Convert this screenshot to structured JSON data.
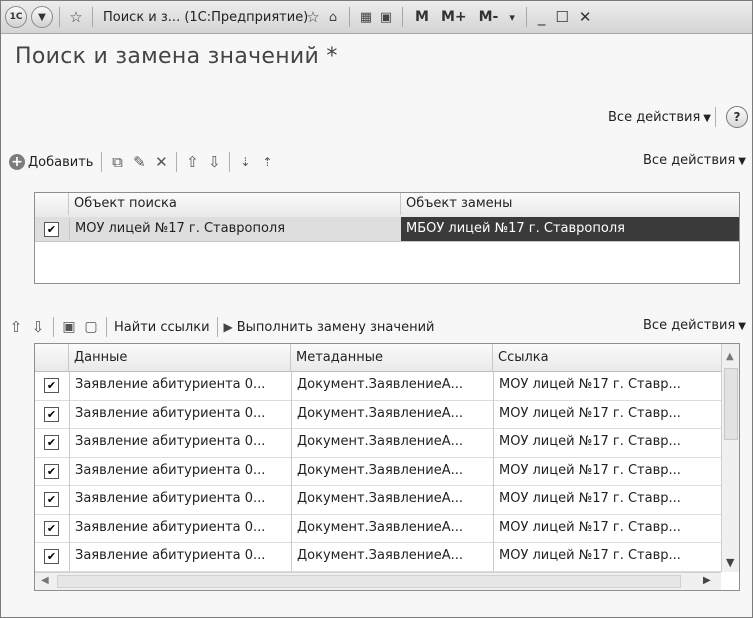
{
  "window": {
    "title": "Поиск и з...  (1С:Предприятие)",
    "logo": "1C",
    "title_bar_icons": [
      "star-icon",
      "star-add-icon",
      "bookmark-icon",
      "calculator-icon",
      "calendar-icon"
    ],
    "memory_buttons": [
      "M",
      "M+",
      "M-"
    ]
  },
  "form": {
    "title": "Поиск и замена значений *",
    "all_actions_label": "Все действия",
    "help_label": "?"
  },
  "toolbar1": {
    "add_label": "Добавить",
    "all_actions_label": "Все действия"
  },
  "grid1": {
    "columns": [
      "Объект поиска",
      "Объект замены"
    ],
    "rows": [
      {
        "checked": true,
        "search": "МОУ лицей №17 г. Ставрополя",
        "replace": "МБОУ лицей №17 г. Ставрополя"
      }
    ]
  },
  "toolbar2": {
    "find_links_label": "Найти ссылки",
    "replace_label": "Выполнить замену значений",
    "all_actions_label": "Все действия"
  },
  "grid2": {
    "columns": [
      "Данные",
      "Метаданные",
      "Ссылка"
    ],
    "rows": [
      {
        "checked": true,
        "data": "Заявление абитуриента 0...",
        "meta": "Документ.ЗаявлениеА...",
        "link": "МОУ лицей №17 г. Ставр..."
      },
      {
        "checked": true,
        "data": "Заявление абитуриента 0...",
        "meta": "Документ.ЗаявлениеА...",
        "link": "МОУ лицей №17 г. Ставр..."
      },
      {
        "checked": true,
        "data": "Заявление абитуриента 0...",
        "meta": "Документ.ЗаявлениеА...",
        "link": "МОУ лицей №17 г. Ставр..."
      },
      {
        "checked": true,
        "data": "Заявление абитуриента 0...",
        "meta": "Документ.ЗаявлениеА...",
        "link": "МОУ лицей №17 г. Ставр..."
      },
      {
        "checked": true,
        "data": "Заявление абитуриента 0...",
        "meta": "Документ.ЗаявлениеА...",
        "link": "МОУ лицей №17 г. Ставр..."
      },
      {
        "checked": true,
        "data": "Заявление абитуриента 0...",
        "meta": "Документ.ЗаявлениеА...",
        "link": "МОУ лицей №17 г. Ставр..."
      },
      {
        "checked": true,
        "data": "Заявление абитуриента 0...",
        "meta": "Документ.ЗаявлениеА...",
        "link": "МОУ лицей №17 г. Ставр..."
      }
    ]
  },
  "colors": {
    "selected_cell_bg": "#3a3a3a",
    "selected_cell_fg": "#ffffff",
    "highlight_row_bg": "#dedede"
  }
}
